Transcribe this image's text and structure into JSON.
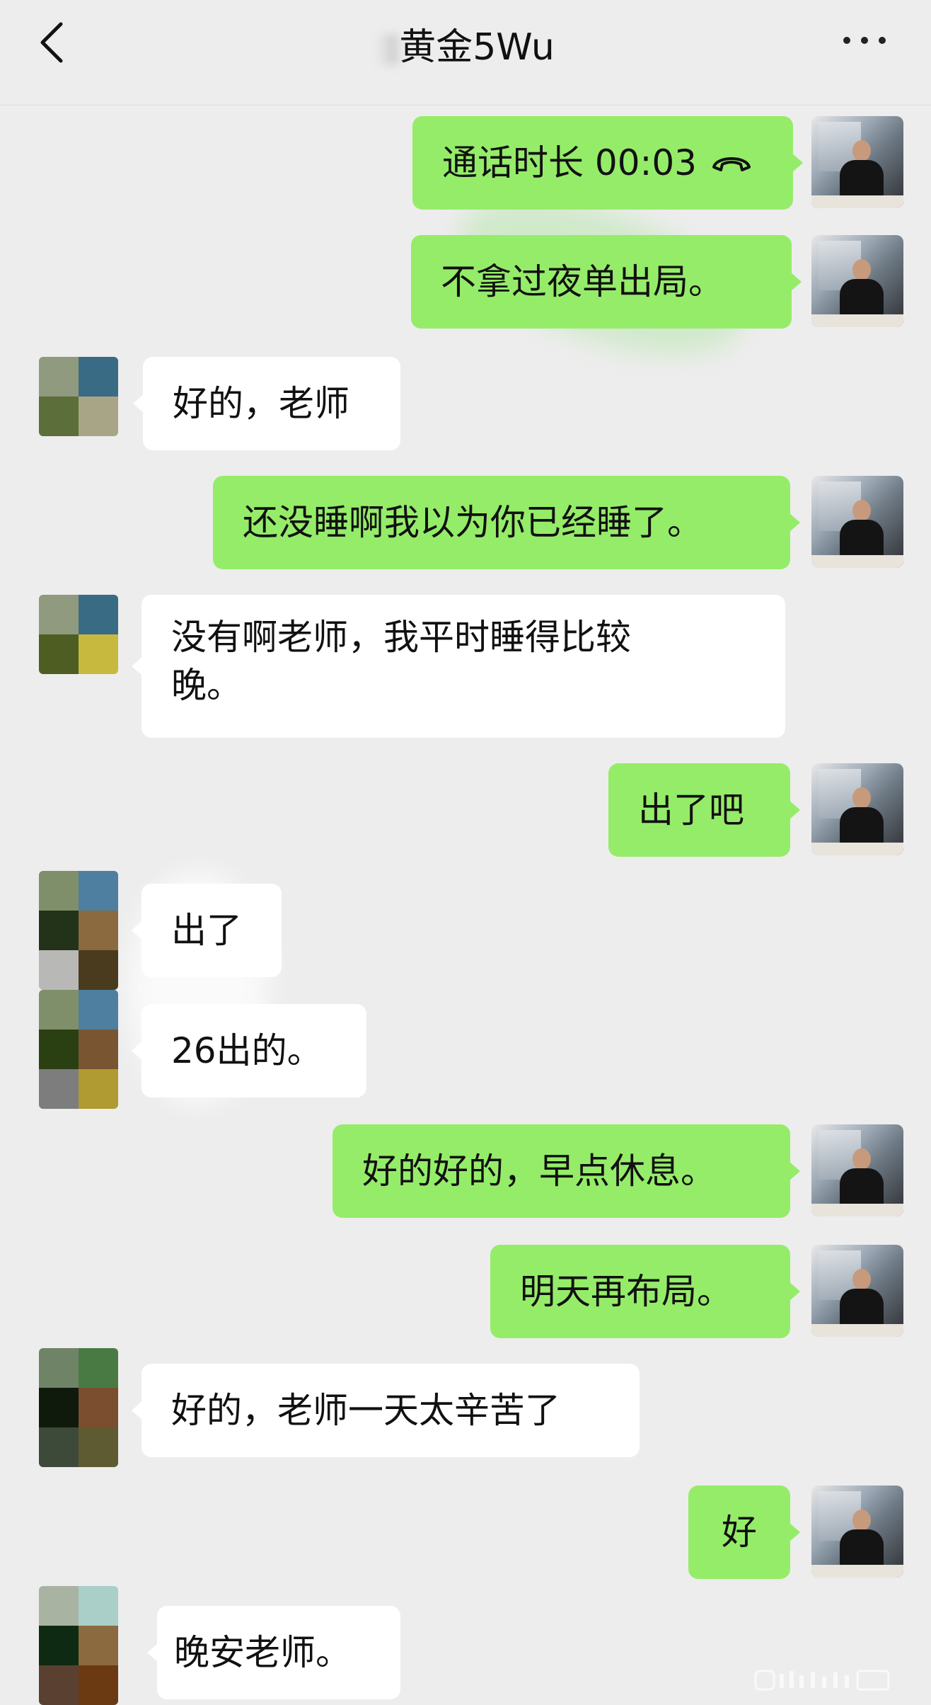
{
  "header": {
    "title": "黄金5Wu"
  },
  "messages": [
    {
      "from": "me",
      "text": "通话时长 00:03",
      "icon": "phone-hangup-icon"
    },
    {
      "from": "me",
      "text": "不拿过夜单出局。"
    },
    {
      "from": "them",
      "text": "好的，老师"
    },
    {
      "from": "me",
      "text": "还没睡啊我以为你已经睡了。"
    },
    {
      "from": "them",
      "text": "没有啊老师，我平时睡得比较晚。"
    },
    {
      "from": "me",
      "text": "出了吧"
    },
    {
      "from": "them",
      "text": "出了"
    },
    {
      "from": "them",
      "text": "26出的。"
    },
    {
      "from": "me",
      "text": "好的好的，早点休息。"
    },
    {
      "from": "me",
      "text": "明天再布局。"
    },
    {
      "from": "them",
      "text": "好的，老师一天太辛苦了"
    },
    {
      "from": "me",
      "text": "好"
    },
    {
      "from": "them",
      "text": "晚安老师。"
    }
  ],
  "colors": {
    "background": "#ededed",
    "my_bubble": "#95ec69",
    "their_bubble": "#ffffff"
  },
  "icons": [
    "back-chevron-icon",
    "more-options-icon",
    "phone-hangup-icon"
  ]
}
